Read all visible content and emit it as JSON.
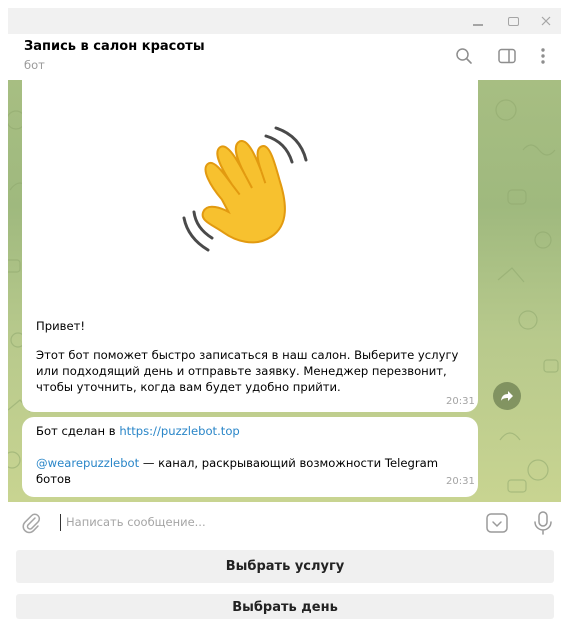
{
  "window": {
    "controls": [
      "minimize-icon",
      "maximize-icon",
      "close-icon"
    ]
  },
  "header": {
    "title": "Запись в салон красоты",
    "subtitle": "бот",
    "icons": [
      "search-icon",
      "sidebar-panel-icon",
      "more-vertical-icon"
    ]
  },
  "messages": [
    {
      "greeting": "Привет!",
      "body": "Этот бот поможет быстро записаться в наш салон. Выберите услугу или подходящий день и отправьте заявку. Менеджер перезвонит, чтобы уточнить, когда вам будет удобно прийти.",
      "time": "20:31",
      "sticker": "waving-hand-emoji"
    },
    {
      "line1_prefix": "Бот сделан в ",
      "line1_link": "https://puzzlebot.top",
      "line2_link": "@wearepuzzlebot",
      "line2_rest": " — канал, раскрывающий возможности Telegram ботов",
      "time": "20:31"
    }
  ],
  "input": {
    "placeholder": "Написать сообщение...",
    "icons": [
      "paperclip-icon",
      "bot-keyboard-icon",
      "microphone-icon"
    ]
  },
  "bot_buttons": [
    {
      "label": "Выбрать услугу"
    },
    {
      "label": "Выбрать день"
    }
  ],
  "colors": {
    "chat_background": "#a7be82",
    "link": "#2a86c8",
    "bubble": "#ffffff",
    "keyboard_button": "#f0f0f0"
  }
}
